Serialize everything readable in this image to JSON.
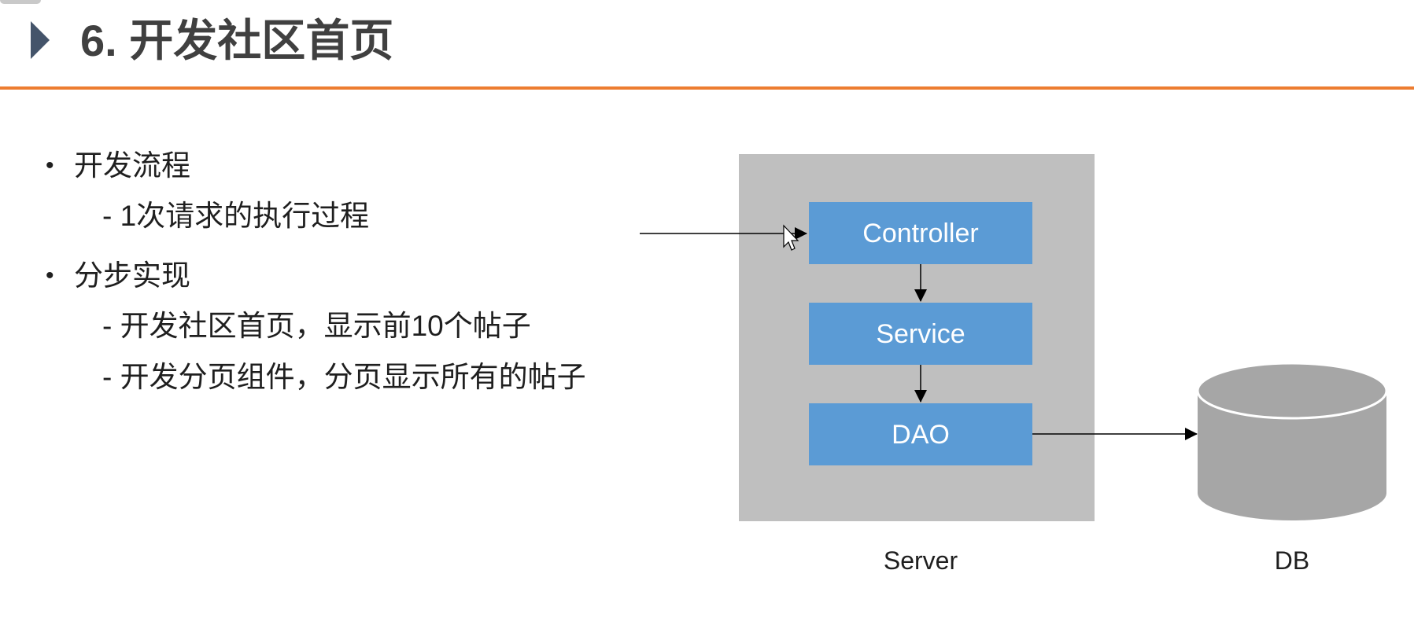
{
  "slide": {
    "title": "6. 开发社区首页",
    "bullets": [
      {
        "text": "开发流程",
        "subitems": [
          "- 1次请求的执行过程"
        ]
      },
      {
        "text": "分步实现",
        "subitems": [
          "-  开发社区首页，显示前10个帖子",
          "-  开发分页组件，分页显示所有的帖子"
        ]
      }
    ]
  },
  "diagram": {
    "boxes": {
      "controller": "Controller",
      "service": "Service",
      "dao": "DAO"
    },
    "server_label": "Server",
    "db_label": "DB",
    "colors": {
      "box_fill": "#5b9bd5",
      "server_fill": "#bfbfbf",
      "db_fill": "#a6a6a6",
      "title_rule": "#ed7d31",
      "title_arrow": "#44546a"
    }
  }
}
